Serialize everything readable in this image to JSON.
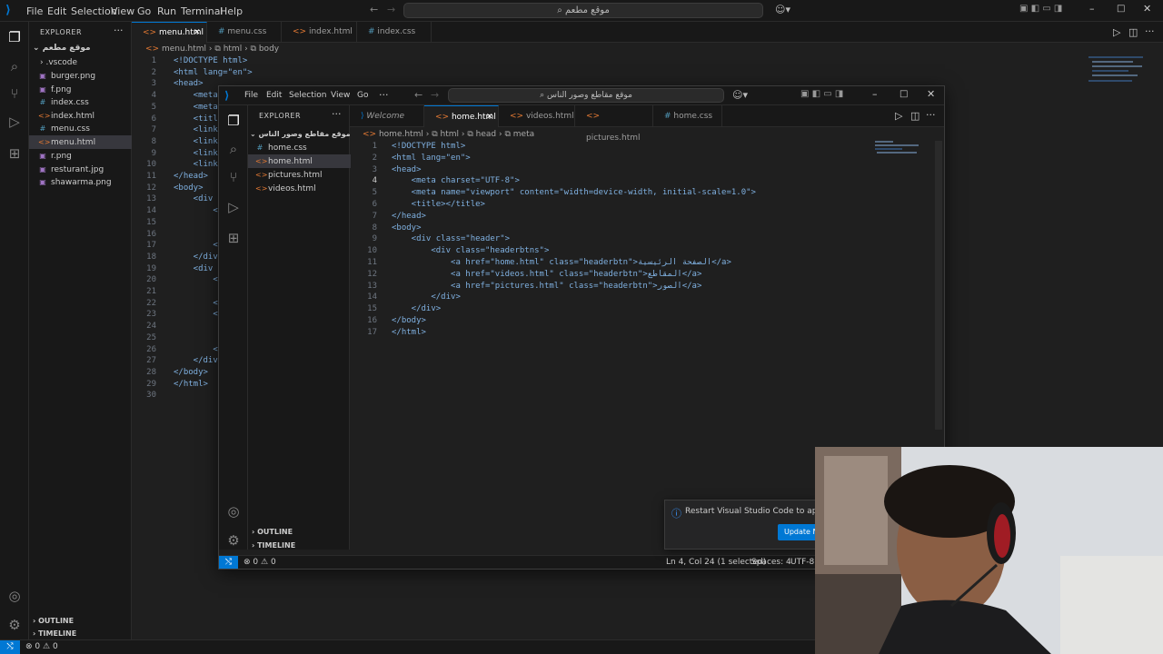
{
  "outer": {
    "menu": [
      "File",
      "Edit",
      "Selection",
      "View",
      "Go",
      "Run",
      "Terminal",
      "Help"
    ],
    "search": "موقع مطعم",
    "explorer_title": "EXPLORER",
    "folder": "موقع مطعم",
    "files": [
      ".vscode",
      "burger.png",
      "f.png",
      "index.css",
      "index.html",
      "menu.css",
      "menu.html",
      "r.png",
      "resturant.jpg",
      "shawarma.png"
    ],
    "tabs": [
      "menu.html",
      "menu.css",
      "index.html",
      "index.css"
    ],
    "breadcrumb": [
      "menu.html",
      "html",
      "body"
    ],
    "line_numbers": [
      "1",
      "2",
      "3",
      "4",
      "5",
      "6",
      "7",
      "8",
      "9",
      "10",
      "11",
      "12",
      "13",
      "14",
      "15",
      "16",
      "17",
      "18",
      "19",
      "20",
      "21",
      "22",
      "23",
      "24",
      "25",
      "26",
      "27",
      "28",
      "29",
      "30"
    ],
    "code": [
      "<!DOCTYPE html>",
      "<html lang=\"en\">",
      "<head>",
      "    <meta",
      "    <meta",
      "    <title",
      "    <link",
      "    <link",
      "    <link",
      "    <link",
      "</head>",
      "<body>",
      "    <div c",
      "        <d",
      "",
      "",
      "        </",
      "    </div",
      "    <div c",
      "        <d",
      "",
      "        </",
      "        <d",
      "",
      "",
      "        </",
      "    </div>",
      "</body>",
      "</html>",
      ""
    ],
    "outline": "OUTLINE",
    "timeline": "TIMELINE",
    "status_problems": "0",
    "status_warnings": "0"
  },
  "inner": {
    "menu": [
      "File",
      "Edit",
      "Selection",
      "View",
      "Go"
    ],
    "search": "موقع مقاطع وصور الناس",
    "explorer_title": "EXPLORER",
    "folder": "موقع مقاطع وصور الناس",
    "files": [
      "home.css",
      "home.html",
      "pictures.html",
      "videos.html"
    ],
    "tabs": [
      "Welcome",
      "home.html",
      "videos.html",
      "pictures.html",
      "home.css"
    ],
    "breadcrumb": [
      "home.html",
      "html",
      "head",
      "meta"
    ],
    "line_numbers": [
      "1",
      "2",
      "3",
      "4",
      "5",
      "6",
      "7",
      "8",
      "9",
      "10",
      "11",
      "12",
      "13",
      "14",
      "15",
      "16",
      "17"
    ],
    "code": [
      "<!DOCTYPE html>",
      "<html lang=\"en\">",
      "<head>",
      "    <meta charset=\"UTF-8\">",
      "    <meta name=\"viewport\" content=\"width=device-width, initial-scale=1.0\">",
      "    <title></title>",
      "</head>",
      "<body>",
      "    <div class=\"header\">",
      "        <div class=\"headerbtns\">",
      "            <a href=\"home.html\" class=\"headerbtn\">الصفحة الرئيسية</a>",
      "            <a href=\"videos.html\" class=\"headerbtn\">المقاطع</a>",
      "            <a href=\"pictures.html\" class=\"headerbtn\">الصور</a>",
      "        </div>",
      "    </div>",
      "</body>",
      "</html>"
    ],
    "outline": "OUTLINE",
    "timeline": "TIMELINE",
    "status_problems": "0",
    "status_warnings": "0",
    "status_position": "Ln 4, Col 24 (1 selected)",
    "status_spaces": "Spaces: 4",
    "status_encoding": "UTF-8"
  },
  "notification": {
    "message": "Restart Visual Studio Code to apply th",
    "button": "Update N"
  },
  "colors": {
    "accent": "#0078d4",
    "tag": "#569cd6",
    "attr": "#9cdcfe",
    "string": "#ce9178",
    "text": "#cccccc"
  }
}
